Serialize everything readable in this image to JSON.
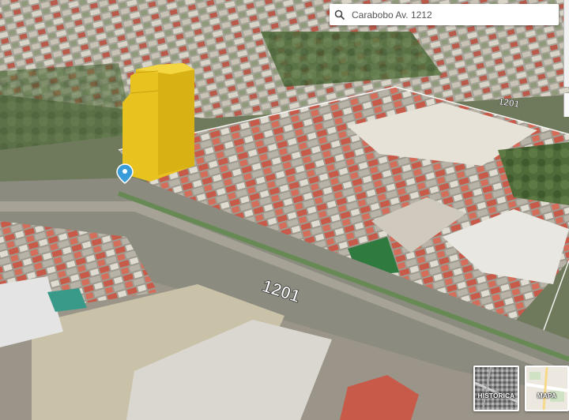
{
  "search": {
    "value": "Carabobo Av. 1212",
    "icon": "search-icon"
  },
  "road_labels": {
    "main": "1201",
    "secondary": "1201"
  },
  "layers": {
    "historic_label": "HISTÓRICA",
    "map_label": "MAPA"
  },
  "colors": {
    "building_highlight": "#e8c21f",
    "pin": "#3a9bd9"
  }
}
